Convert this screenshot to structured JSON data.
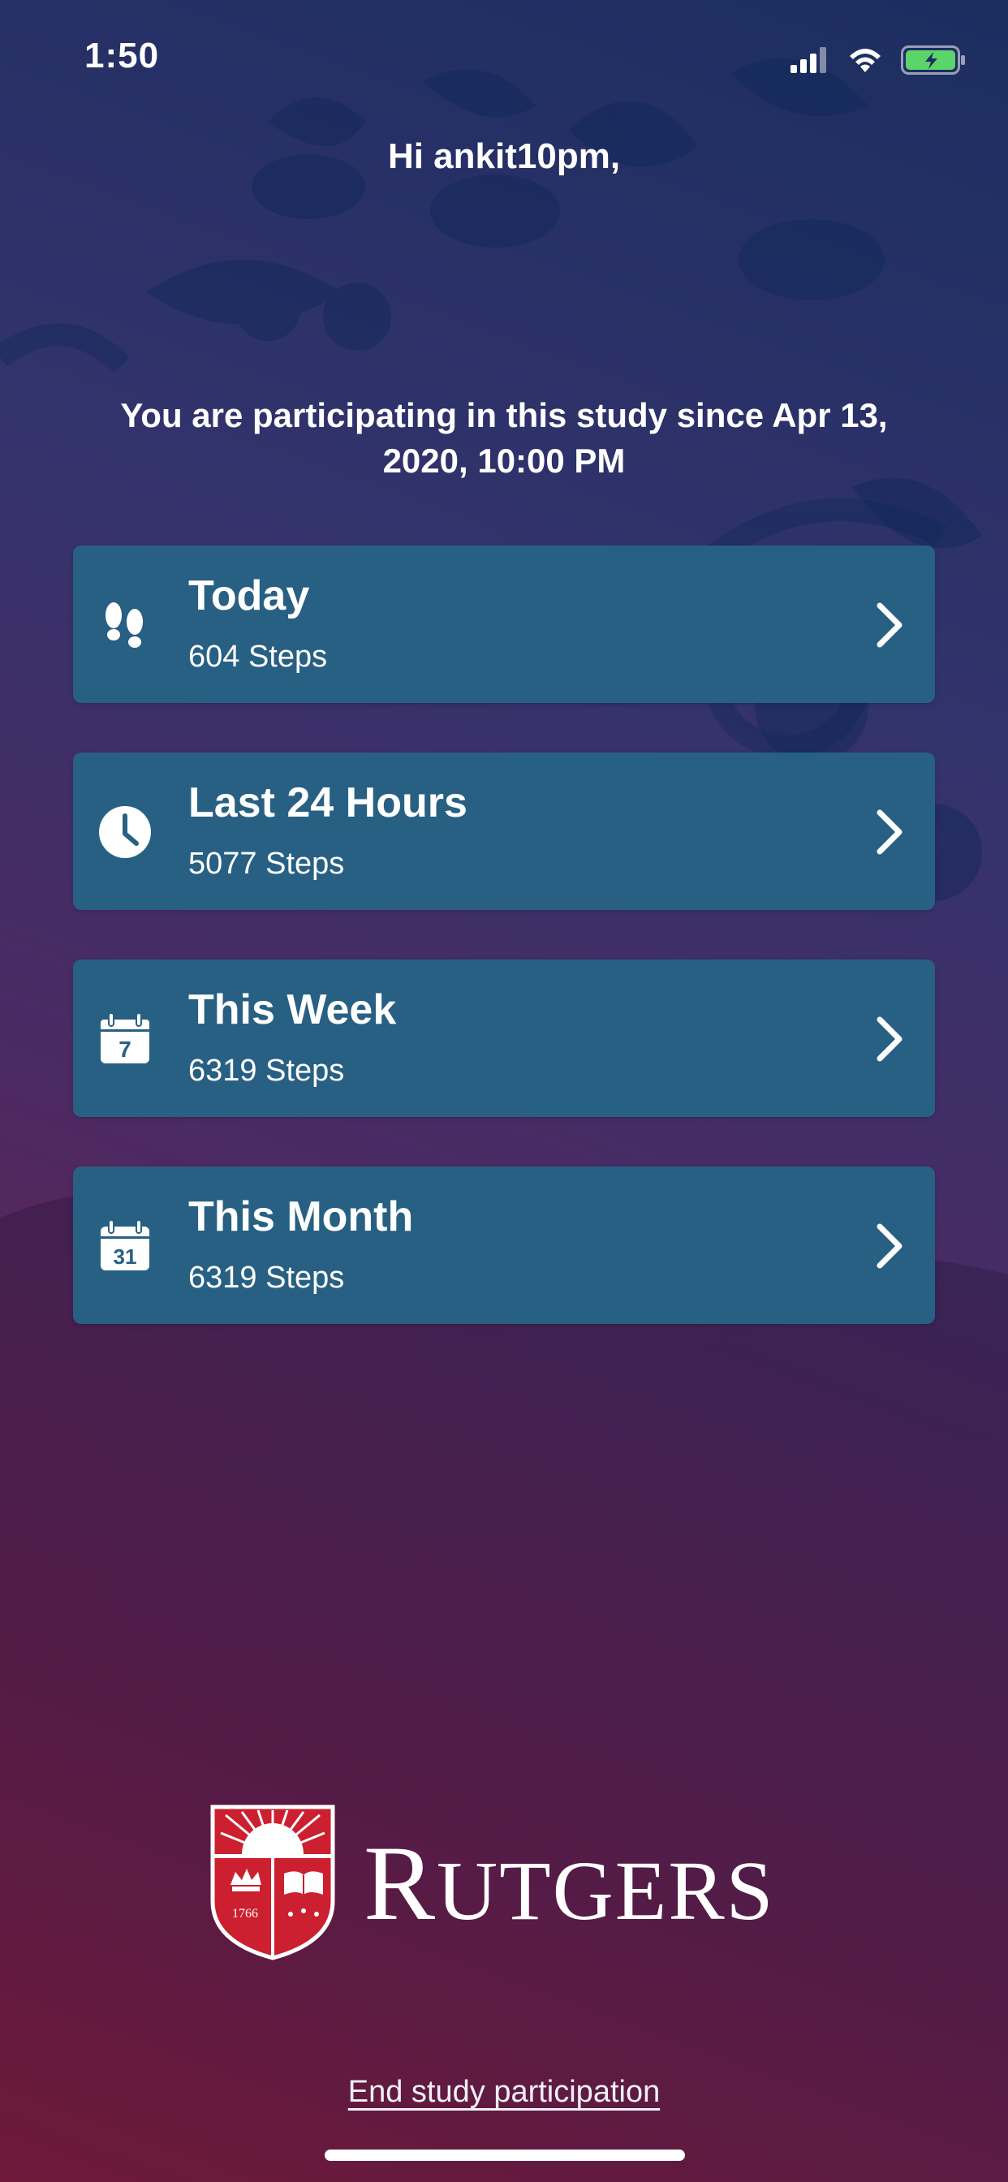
{
  "status_bar": {
    "time": "1:50",
    "icons": [
      "cellular-signal-icon",
      "wifi-icon",
      "battery-charging-icon"
    ]
  },
  "greeting": "Hi ankit10pm,",
  "participation_text": "You are participating in this study since Apr 13, 2020, 10:00 PM",
  "cards": [
    {
      "title": "Today",
      "subtitle": "604 Steps",
      "icon": "footsteps-icon"
    },
    {
      "title": "Last 24 Hours",
      "subtitle": "5077 Steps",
      "icon": "clock-icon"
    },
    {
      "title": "This Week",
      "subtitle": "6319 Steps",
      "icon": "calendar-week-icon",
      "icon_text": "7"
    },
    {
      "title": "This Month",
      "subtitle": "6319 Steps",
      "icon": "calendar-month-icon",
      "icon_text": "31"
    }
  ],
  "logo": {
    "wordmark_first": "R",
    "wordmark_rest": "UTGERS",
    "shield_year": "1766"
  },
  "end_link": "End study participation",
  "colors": {
    "card_bg": "#286084",
    "battery_fill": "#5bd46a",
    "shield_red": "#cc1f2f"
  }
}
